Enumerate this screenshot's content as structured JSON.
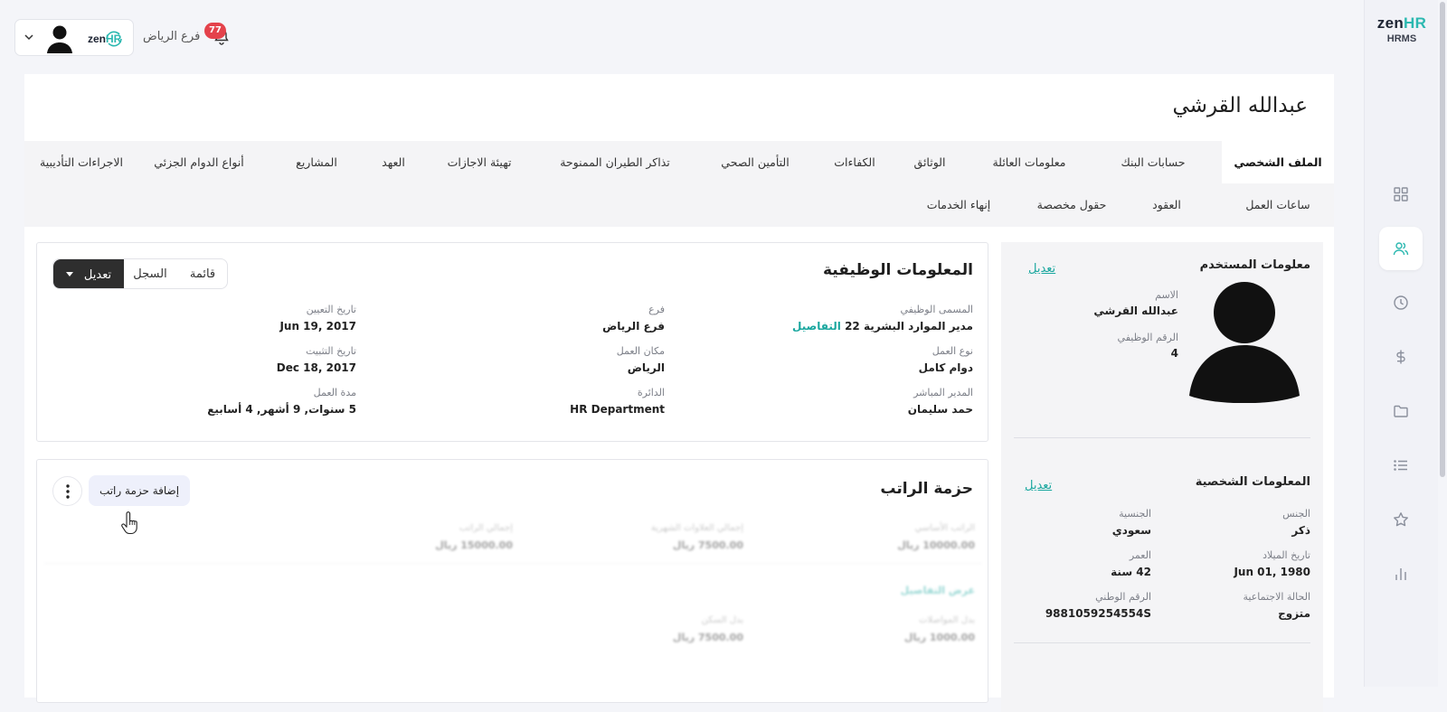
{
  "brand": {
    "logo_prefix": "zen",
    "logo_suffix": "HR",
    "subtitle": "HRMS",
    "accent_color": "#2bb8b0"
  },
  "topbar": {
    "branch_label": "فرع الرياض",
    "notification_count": "77",
    "company_logo_prefix": "zen",
    "company_logo_suffix": "HR"
  },
  "rail": {
    "items": [
      {
        "icon": "grid-icon",
        "active": false
      },
      {
        "icon": "users-icon",
        "active": true
      },
      {
        "icon": "clock-icon",
        "active": false
      },
      {
        "icon": "dollar-icon",
        "active": false
      },
      {
        "icon": "folder-icon",
        "active": false
      },
      {
        "icon": "list-icon",
        "active": false
      },
      {
        "icon": "star-icon",
        "active": false
      },
      {
        "icon": "bar-chart-icon",
        "active": false
      }
    ]
  },
  "employee": {
    "name": "عبدالله القرشي"
  },
  "tabs": {
    "row1": [
      "الملف الشخصي",
      "حسابات البنك",
      "معلومات العائلة",
      "الوثائق",
      "الكفاءات",
      "التأمين الصحي",
      "تذاكر الطيران الممنوحة",
      "تهيئة الاجازات",
      "العهد",
      "المشاريع",
      "أنواع الدوام الجزئي",
      "الاجراءات التأديبية"
    ],
    "row2": [
      "ساعات العمل",
      "العقود",
      "حقول مخصصة",
      "إنهاء الخدمات"
    ]
  },
  "user_info": {
    "title": "معلومات المستخدم",
    "edit_label": "تعديل",
    "name_label": "الاسم",
    "name_value": "عبدالله القرشي",
    "employee_number_label": "الرقم الوظيفي",
    "employee_number_value": "4"
  },
  "personal_info": {
    "title": "المعلومات الشخصية",
    "edit_label": "تعديل",
    "gender_label": "الجنس",
    "gender_value": "ذكر",
    "nationality_label": "الجنسية",
    "nationality_value": "سعودي",
    "birth_date_label": "تاريخ الميلاد",
    "birth_date_value": "Jun 01, 1980",
    "age_label": "العمر",
    "age_value": "42 سنة",
    "marital_label": "الحالة الاجتماعية",
    "marital_value": "متزوج",
    "national_id_label": "الرقم الوطني",
    "national_id_value": "9881059254554S"
  },
  "job_info": {
    "title": "المعلومات الوظيفية",
    "list_label": "قائمة",
    "history_label": "السجل",
    "edit_label": "تعديل",
    "job_title_label": "المسمى الوظيفي",
    "job_title_value": "مدير الموارد البشرية 22",
    "details_link": "التفاصيل",
    "branch_label": "فرع",
    "branch_value": "فرع الرياض",
    "hire_date_label": "تاريخ التعيين",
    "hire_date_value": "Jun 19, 2017",
    "work_type_label": "نوع العمل",
    "work_type_value": "دوام كامل",
    "work_place_label": "مكان العمل",
    "work_place_value": "الرياض",
    "confirm_date_label": "تاريخ التثبيت",
    "confirm_date_value": "Dec 18, 2017",
    "manager_label": "المدير المباشر",
    "manager_value": "حمد سليمان",
    "department_label": "الدائرة",
    "department_value": "HR Department",
    "duration_label": "مدة العمل",
    "duration_value": "5 سنوات, 9 أشهر, 4 أسابيع"
  },
  "salary": {
    "title": "حزمة الراتب",
    "add_label": "إضافة حزمة راتب",
    "blurred": {
      "l1": "الراتب الأساسي",
      "v1": "10000.00 ريال",
      "l2": "إجمالي العلاوات الشهرية",
      "v2": "7500.00 ريال",
      "l3": "إجمالي الراتب",
      "v3": "15000.00 ريال",
      "link": "عرض التفاصيل",
      "l4": "بدل المواصلات",
      "v4": "1000.00 ريال",
      "l5": "بدل السكن",
      "v5": "7500.00 ريال"
    }
  }
}
